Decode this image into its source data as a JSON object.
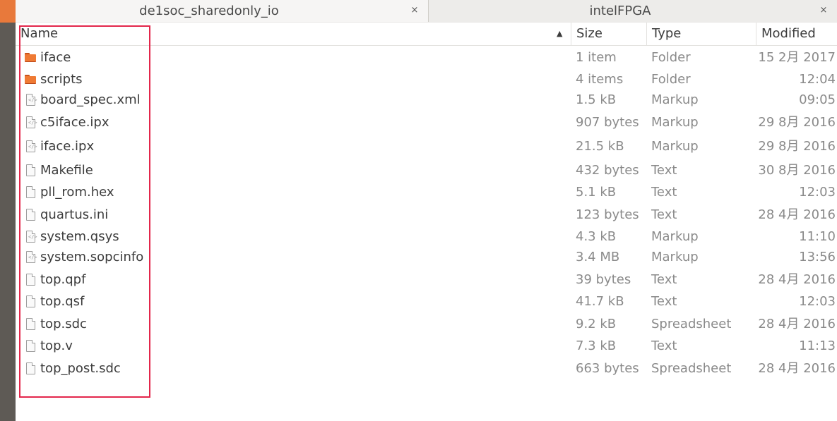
{
  "tabs": [
    {
      "label": "de1soc_sharedonly_io",
      "close": "×"
    },
    {
      "label": "intelFPGA",
      "close": "×"
    }
  ],
  "columns": {
    "name": "Name",
    "size": "Size",
    "type": "Type",
    "modified": "Modified",
    "sort_indicator": "▲"
  },
  "files": [
    {
      "name": "iface",
      "size": "1 item",
      "type": "Folder",
      "modified": "15 2月 2017",
      "icon": "folder-icon"
    },
    {
      "name": "scripts",
      "size": "4 items",
      "type": "Folder",
      "modified": "12:04",
      "icon": "folder-icon"
    },
    {
      "name": "board_spec.xml",
      "size": "1.5 kB",
      "type": "Markup",
      "modified": "09:05",
      "icon": "markup-file-icon"
    },
    {
      "name": "c5iface.ipx",
      "size": "907 bytes",
      "type": "Markup",
      "modified": "29 8月 2016",
      "icon": "markup-file-icon"
    },
    {
      "name": "iface.ipx",
      "size": "21.5 kB",
      "type": "Markup",
      "modified": "29 8月 2016",
      "icon": "markup-file-icon"
    },
    {
      "name": "Makefile",
      "size": "432 bytes",
      "type": "Text",
      "modified": "30 8月 2016",
      "icon": "text-file-icon"
    },
    {
      "name": "pll_rom.hex",
      "size": "5.1 kB",
      "type": "Text",
      "modified": "12:03",
      "icon": "text-file-icon"
    },
    {
      "name": "quartus.ini",
      "size": "123 bytes",
      "type": "Text",
      "modified": "28 4月 2016",
      "icon": "text-file-icon"
    },
    {
      "name": "system.qsys",
      "size": "4.3 kB",
      "type": "Markup",
      "modified": "11:10",
      "icon": "markup-file-icon"
    },
    {
      "name": "system.sopcinfo",
      "size": "3.4 MB",
      "type": "Markup",
      "modified": "13:56",
      "icon": "markup-file-icon"
    },
    {
      "name": "top.qpf",
      "size": "39 bytes",
      "type": "Text",
      "modified": "28 4月 2016",
      "icon": "text-file-icon"
    },
    {
      "name": "top.qsf",
      "size": "41.7 kB",
      "type": "Text",
      "modified": "12:03",
      "icon": "text-file-icon"
    },
    {
      "name": "top.sdc",
      "size": "9.2 kB",
      "type": "Spreadsheet",
      "modified": "28 4月 2016",
      "icon": "text-file-icon"
    },
    {
      "name": "top.v",
      "size": "7.3 kB",
      "type": "Text",
      "modified": "11:13",
      "icon": "text-file-icon"
    },
    {
      "name": "top_post.sdc",
      "size": "663 bytes",
      "type": "Spreadsheet",
      "modified": "28 4月 2016",
      "icon": "text-file-icon"
    }
  ],
  "colors": {
    "annotation": "#e3264b",
    "folder": "#ef7a34",
    "dock_accent": "#e8793b"
  }
}
